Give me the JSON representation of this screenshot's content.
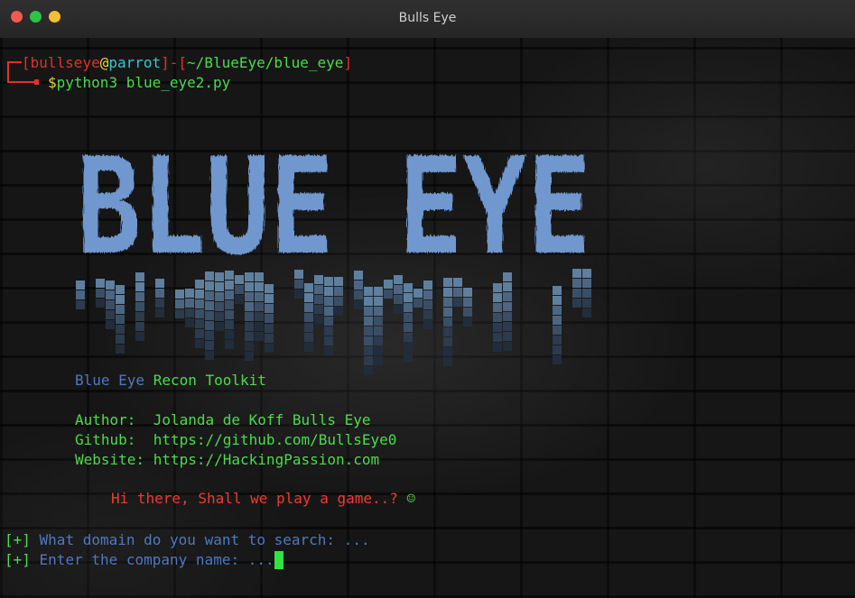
{
  "window": {
    "title": "Bulls Eye"
  },
  "prompt": {
    "open_bracket": "[",
    "user": "bullseye",
    "at": "@",
    "host": "parrot",
    "separator": "]-[",
    "path": "~/BlueEye/blue_eye",
    "close_bracket": "]",
    "symbol": "$",
    "command": "python3 blue_eye2.py"
  },
  "banner": {
    "text": "BLUE EYE",
    "color": "#7098cf"
  },
  "info": {
    "tool_name": "Blue Eye",
    "tool_suffix": " Recon Toolkit",
    "author_label": "Author:  ",
    "author": "Jolanda de Koff Bulls Eye",
    "github_label": "Github:  ",
    "github": "https://github.com/BullsEye0",
    "website_label": "Website: ",
    "website": "https://HackingPassion.com",
    "greeting": "Hi there, Shall we play a game..? ",
    "smiley": "☺"
  },
  "input_prompts": [
    {
      "marker": "[+]",
      "text": " What domain do you want to search: ..."
    },
    {
      "marker": "[+]",
      "text": " Enter the company name: ..."
    }
  ],
  "colors": {
    "prompt_red": "#e2312a",
    "host_cyan": "#37c7cf",
    "text_green": "#4bdc4b",
    "text_blue": "#4f78c2",
    "greeting_red": "#f23a2e",
    "cursor_green": "#32e33f"
  }
}
